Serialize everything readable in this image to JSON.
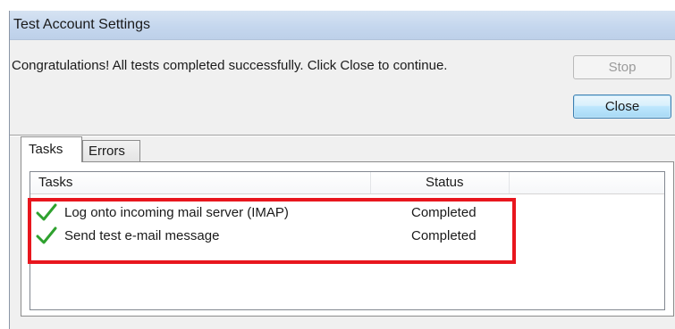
{
  "window": {
    "title": "Test Account Settings"
  },
  "message": "Congratulations! All tests completed successfully. Click Close to continue.",
  "buttons": {
    "stop_label": "Stop",
    "close_label": "Close"
  },
  "tabs": [
    {
      "label": "Tasks",
      "selected": true
    },
    {
      "label": "Errors",
      "selected": false
    }
  ],
  "table": {
    "columns": [
      "Tasks",
      "Status"
    ],
    "rows": [
      {
        "icon": "checkmark-icon",
        "task": "Log onto incoming mail server (IMAP)",
        "status": "Completed"
      },
      {
        "icon": "checkmark-icon",
        "task": "Send test e-mail message",
        "status": "Completed"
      }
    ]
  },
  "colors": {
    "check_green": "#2ea12e",
    "highlight_red": "#e8161e",
    "close_button_border": "#3c7fb1",
    "title_bar": "#c5d7ee"
  }
}
